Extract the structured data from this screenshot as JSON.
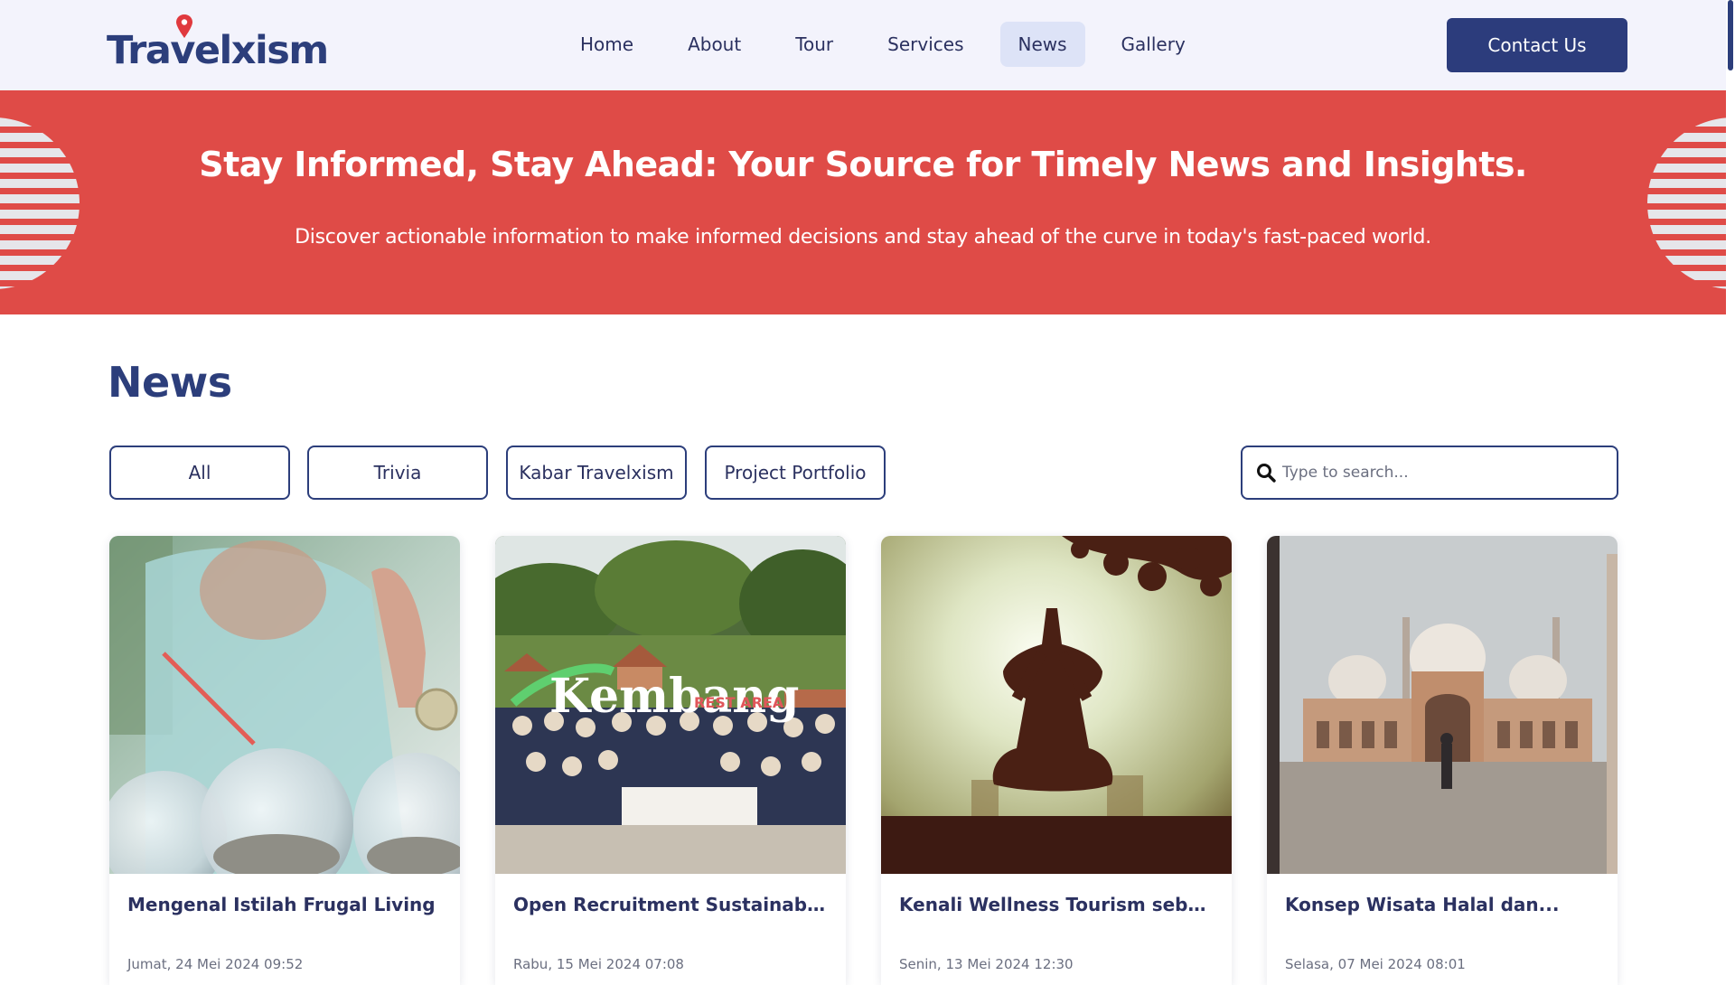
{
  "brand": {
    "logo_text": "Travelxism"
  },
  "nav": {
    "items": [
      {
        "label": "Home",
        "active": false
      },
      {
        "label": "About",
        "active": false
      },
      {
        "label": "Tour",
        "active": false
      },
      {
        "label": "Services",
        "active": false
      },
      {
        "label": "News",
        "active": true
      },
      {
        "label": "Gallery",
        "active": false
      }
    ],
    "contact_label": "Contact Us"
  },
  "hero": {
    "title": "Stay Informed, Stay Ahead: Your Source for Timely News and Insights.",
    "subtitle": "Discover actionable information to make informed decisions and stay ahead of the curve in today's fast-paced world."
  },
  "news": {
    "heading": "News",
    "filters": [
      "All",
      "Trivia",
      "Kabar Travelxism",
      "Project Portfolio"
    ],
    "search": {
      "placeholder": "Type to search...",
      "value": ""
    },
    "cards": [
      {
        "title": "Mengenal Istilah Frugal Living",
        "date": "Jumat, 24 Mei 2024 09:52",
        "image": "coin-jars-photo"
      },
      {
        "title": "Open Recruitment Sustainable...",
        "date": "Rabu, 15 Mei 2024 07:08",
        "image": "group-photo-kembang",
        "image_text": "Kembang",
        "image_sign": "REST AREA"
      },
      {
        "title": "Kenali Wellness Tourism sebaga...",
        "date": "Senin, 13 Mei 2024 12:30",
        "image": "yoga-silhouette-photo"
      },
      {
        "title": "Konsep Wisata Halal dan...",
        "date": "Selasa, 07 Mei 2024 08:01",
        "image": "mosque-photo"
      }
    ]
  },
  "colors": {
    "brand_navy": "#2c3e7b",
    "hero_red": "#df4b47",
    "header_bg": "#f3f3fc",
    "nav_active_bg": "#dde3f7"
  }
}
